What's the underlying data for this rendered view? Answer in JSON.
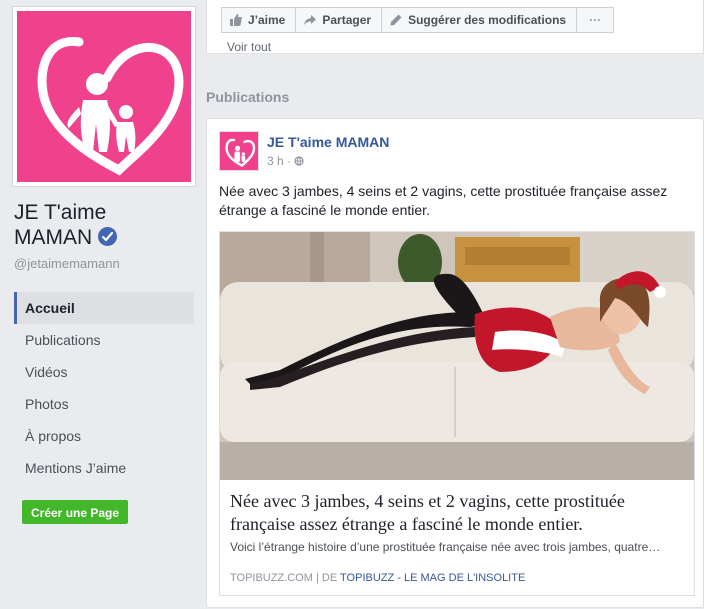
{
  "page": {
    "name_line1": "JE T'aime",
    "name_line2": "MAMAN",
    "handle": "@jetaimemamann"
  },
  "nav": {
    "items": [
      {
        "label": "Accueil"
      },
      {
        "label": "Publications"
      },
      {
        "label": "Vidéos"
      },
      {
        "label": "Photos"
      },
      {
        "label": "À propos"
      },
      {
        "label": "Mentions J’aime"
      }
    ],
    "create_button": "Créer une Page"
  },
  "actions": {
    "like": "J’aime",
    "share": "Partager",
    "suggest": "Suggérer des modifications",
    "more": "···",
    "see_all": "Voir tout"
  },
  "section": {
    "title": "Publications"
  },
  "post": {
    "author": "JE T'aime MAMAN",
    "time": "3 h",
    "separator": "·",
    "text": "Née avec 3 jambes, 4 seins et 2 vagins, cette prostituée française assez étrange a fasciné le monde entier.",
    "link": {
      "title": "Née avec 3 jambes, 4 seins et 2 vagins, cette prostituée française assez étrange a fasciné le monde entier.",
      "description": "Voici l’étrange histoire d’une prostituée française née avec trois jambes, quatre…",
      "domain": "TOPIBUZZ.COM",
      "by_prefix": " | DE ",
      "by": "TOPIBUZZ - LE MAG DE L'INSOLITE"
    }
  },
  "colors": {
    "brand_pink": "#f0418c",
    "fb_blue": "#4267b2",
    "link_blue": "#365899",
    "green": "#42b72a"
  }
}
